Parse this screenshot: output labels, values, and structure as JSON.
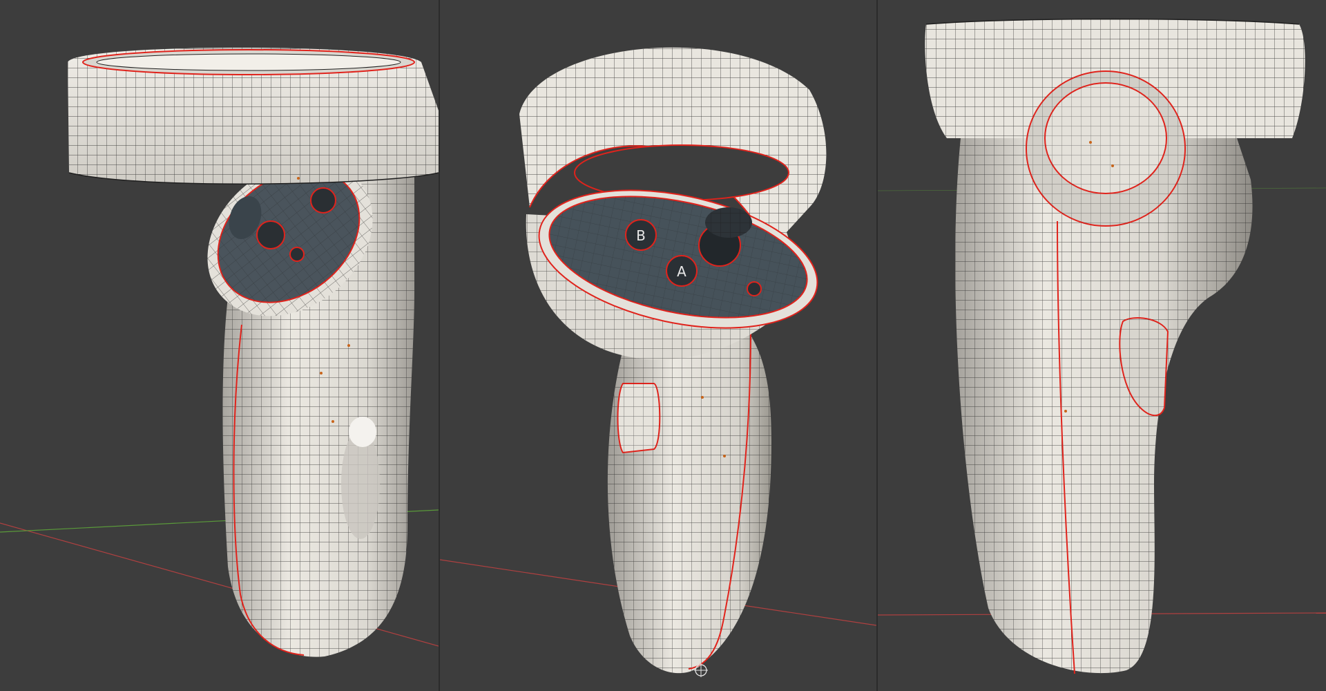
{
  "scene": {
    "description_free": true,
    "views": [
      {
        "id": "left",
        "button_labels": [
          "",
          "",
          ""
        ]
      },
      {
        "id": "center",
        "button_labels": [
          "B",
          "A"
        ]
      },
      {
        "id": "right",
        "button_labels": []
      }
    ]
  },
  "colors": {
    "background": "#3d3d3d",
    "shell": "#e4e1da",
    "shell_shadow": "#a9a6a0",
    "wire": "#1f1f1f",
    "seam": "#e0231c",
    "faceplate": "#3f4a52",
    "axis_x": "#b04040",
    "axis_y": "#5a9a3a"
  },
  "icons": {
    "origin": "origin-crosshair-icon"
  }
}
